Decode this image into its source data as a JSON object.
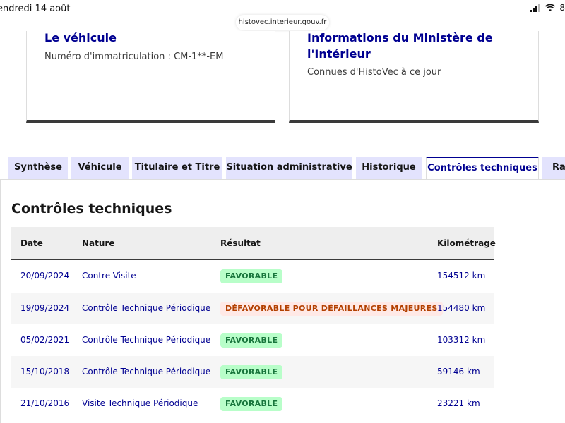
{
  "status_bar": {
    "date": "endredi 14 août",
    "battery": "8"
  },
  "browser": {
    "url": "histovec.interieur.gouv.fr"
  },
  "cards": [
    {
      "title": "Le véhicule",
      "description": "Numéro d'immatriculation : CM-1**-EM"
    },
    {
      "title": "Informations du Ministère de l'Intérieur",
      "description": "Connues d'HistoVec à ce jour"
    }
  ],
  "tabs": [
    {
      "label": "Synthèse",
      "active": false
    },
    {
      "label": "Véhicule",
      "active": false
    },
    {
      "label": "Titulaire et Titre",
      "active": false
    },
    {
      "label": "Situation administrative",
      "active": false
    },
    {
      "label": "Historique",
      "active": false
    },
    {
      "label": "Contrôles techniques",
      "active": true
    },
    {
      "label": "Rap",
      "active": false
    }
  ],
  "section_title": "Contrôles techniques",
  "table": {
    "headers": {
      "date": "Date",
      "nature": "Nature",
      "result": "Résultat",
      "km": "Kilométrage"
    },
    "rows": [
      {
        "date": "20/09/2024",
        "nature": "Contre-Visite",
        "result": "FAVORABLE",
        "status": "ok",
        "km": "154512 km"
      },
      {
        "date": "19/09/2024",
        "nature": "Contrôle Technique Périodique",
        "result": "DÉFAVORABLE POUR DÉFAILLANCES MAJEURES",
        "status": "ko",
        "km": "154480 km"
      },
      {
        "date": "05/02/2021",
        "nature": "Contrôle Technique Périodique",
        "result": "FAVORABLE",
        "status": "ok",
        "km": "103312 km"
      },
      {
        "date": "15/10/2018",
        "nature": "Contrôle Technique Périodique",
        "result": "FAVORABLE",
        "status": "ok",
        "km": "59146 km"
      },
      {
        "date": "21/10/2016",
        "nature": "Visite Technique Périodique",
        "result": "FAVORABLE",
        "status": "ok",
        "km": "23221 km"
      }
    ]
  },
  "colors": {
    "primary_blue": "#000091",
    "tab_inactive_bg": "#e3e3fd",
    "favorable_bg": "#b8fec9",
    "favorable_text": "#18753c",
    "defavorable_bg": "#ffe9e6",
    "defavorable_text": "#b34000"
  }
}
